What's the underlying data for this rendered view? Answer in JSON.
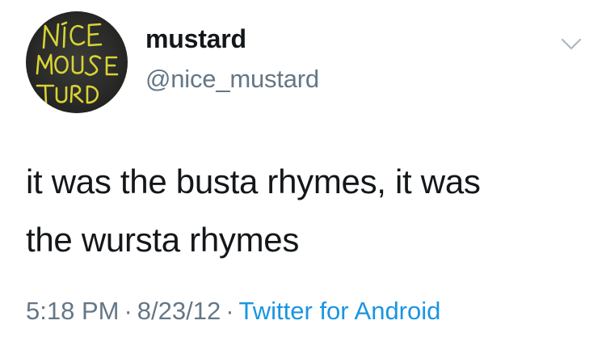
{
  "tweet": {
    "author": {
      "display_name": "mustard",
      "handle": "@nice_mustard",
      "avatar_text": [
        "NICE",
        "MOUSE",
        "TURD"
      ]
    },
    "text_lines": [
      "it was the busta rhymes, it was",
      "the wursta rhymes"
    ],
    "meta": {
      "time": "5:18 PM",
      "separator": "·",
      "date": "8/23/12",
      "source": "Twitter for Android"
    },
    "icons": {
      "menu": "chevron-down-icon"
    },
    "colors": {
      "text": "#14171a",
      "secondary": "#657786",
      "link": "#1b95e0",
      "avatar_bg": "#2a2a28",
      "avatar_text": "#d8d335"
    }
  }
}
